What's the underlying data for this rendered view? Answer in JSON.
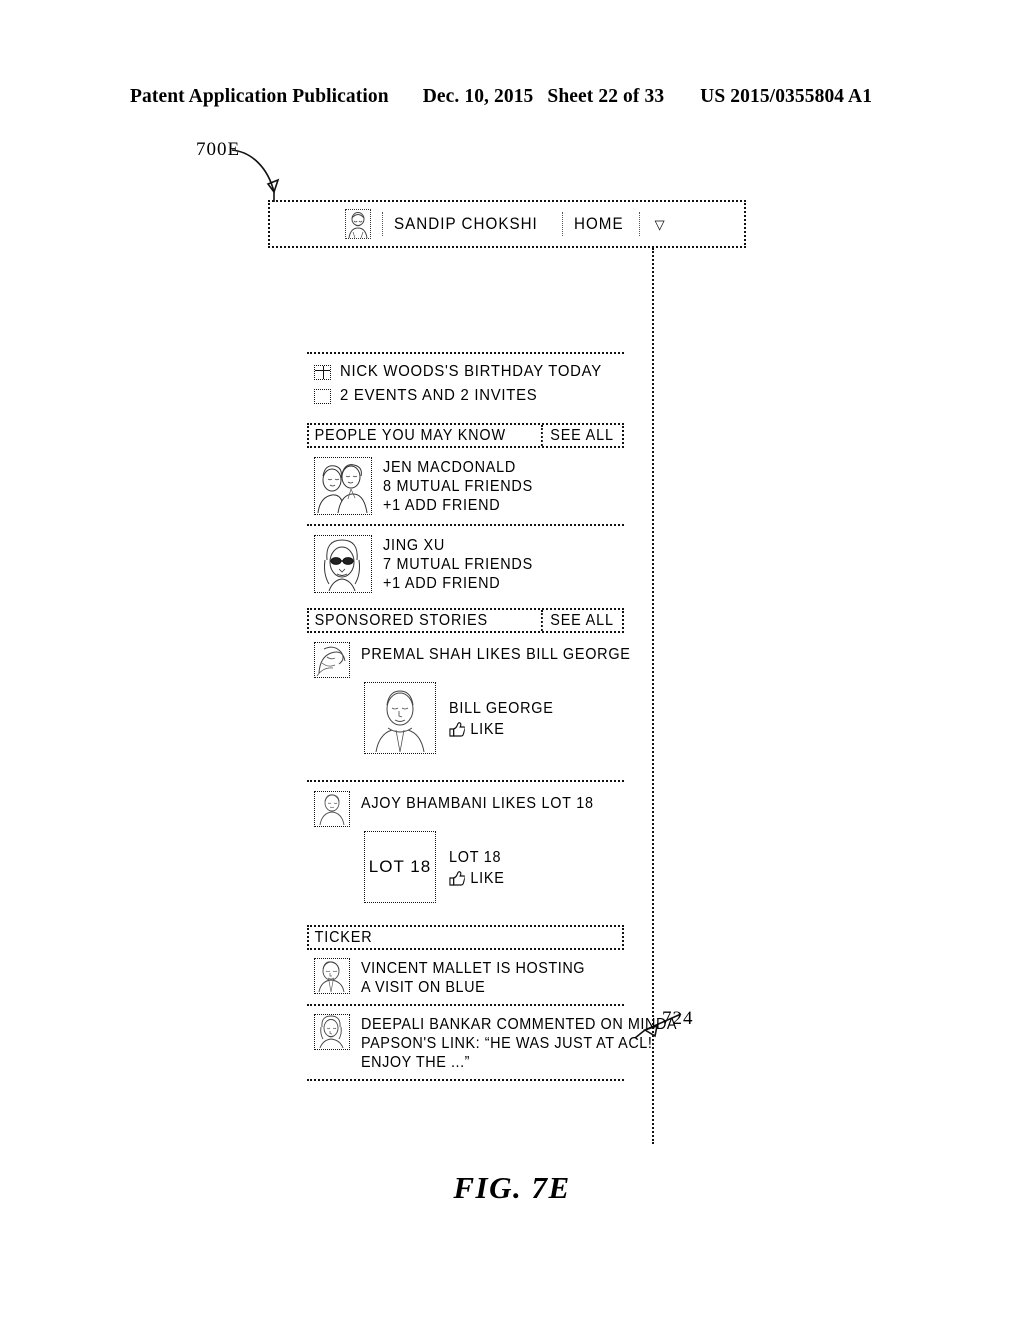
{
  "patent_header": {
    "publication": "Patent Application Publication",
    "date": "Dec. 10, 2015",
    "sheet": "Sheet 22 of 33",
    "number": "US 2015/0355804 A1"
  },
  "figure": {
    "caption": "FIG. 7E",
    "ref_main": "700E",
    "ref_ticker": "724"
  },
  "nav": {
    "avatar_icon": "user-avatar-portrait-icon",
    "user_name": "SANDIP CHOKSHI",
    "home_label": "HOME",
    "caret_icon": "▽"
  },
  "notifications": [
    {
      "icon": "calendar-icon",
      "text": "NICK WOODS'S BIRTHDAY TODAY"
    },
    {
      "icon": "square-icon",
      "text": "2 EVENTS AND 2 INVITES"
    }
  ],
  "people_section": {
    "title": "PEOPLE YOU MAY KNOW",
    "action": "SEE ALL",
    "people": [
      {
        "thumb_icon": "two-people-photo-icon",
        "name": "JEN MACDONALD",
        "mutual": "8 MUTUAL FRIENDS",
        "add": "+1 ADD FRIEND"
      },
      {
        "thumb_icon": "woman-sunglasses-photo-icon",
        "name": "JING XU",
        "mutual": "7 MUTUAL FRIENDS",
        "add": "+1 ADD FRIEND"
      }
    ]
  },
  "sponsored_section": {
    "title": "SPONSORED STORIES",
    "action": "SEE ALL",
    "stories": [
      {
        "actor_thumb_icon": "premal-shah-photo-icon",
        "headline": "PREMAL SHAH LIKES BILL GEORGE",
        "card_image_icon": "bill-george-portrait-icon",
        "card_image_text": "",
        "card_title": "BILL GEORGE",
        "like_icon": "thumbs-up-icon",
        "like_label": "LIKE"
      },
      {
        "actor_thumb_icon": "ajoy-bhambani-photo-icon",
        "headline": "AJOY BHAMBANI LIKES LOT 18",
        "card_image_icon": "lot-18-logo-icon",
        "card_image_text": "LOT 18",
        "card_title": "LOT 18",
        "like_icon": "thumbs-up-icon",
        "like_label": "LIKE"
      }
    ]
  },
  "ticker_section": {
    "title": "TICKER",
    "items": [
      {
        "thumb_icon": "vincent-mallet-photo-icon",
        "lines": [
          "VINCENT MALLET IS HOSTING",
          "A VISIT ON BLUE"
        ]
      },
      {
        "thumb_icon": "deepali-bankar-photo-icon",
        "lines": [
          "DEEPALI BANKAR COMMENTED ON MINDA",
          "PAPSON'S LINK: “HE WAS JUST AT ACL!",
          "ENJOY THE ...”"
        ]
      }
    ]
  },
  "colors": {
    "ink": "#000000",
    "paper": "#ffffff"
  }
}
